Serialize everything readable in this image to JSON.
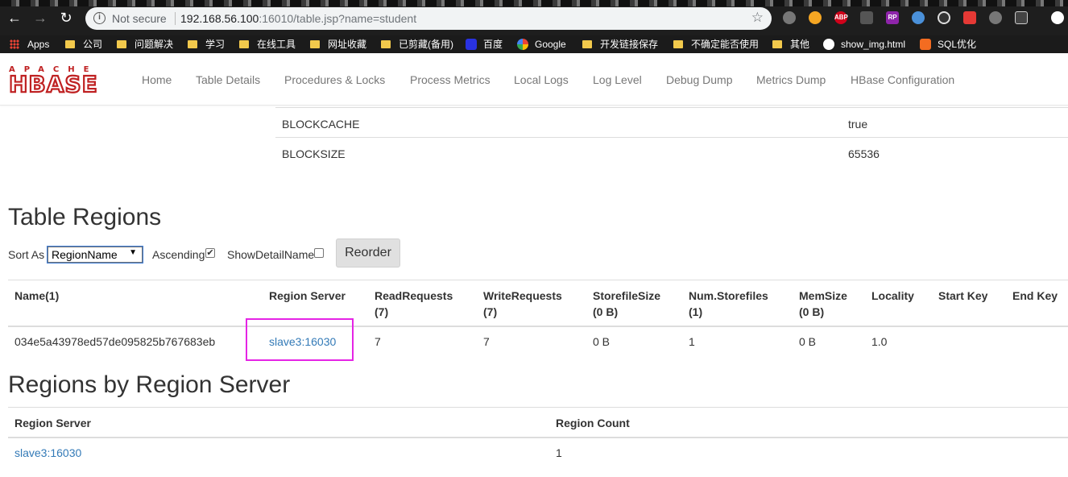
{
  "browser": {
    "security": "Not secure",
    "url_host": "192.168.56.100",
    "url_rest": ":16010/table.jsp?name=student"
  },
  "bookmarks": [
    "Apps",
    "公司",
    "问题解决",
    "学习",
    "在线工具",
    "网址收藏",
    "已剪藏(备用)",
    "百度",
    "Google",
    "开发链接保存",
    "不确定能否使用",
    "其他",
    "show_img.html",
    "SQL优化"
  ],
  "logo": {
    "top": "APACHE",
    "main": "HBASE"
  },
  "nav": [
    "Home",
    "Table Details",
    "Procedures & Locks",
    "Process Metrics",
    "Local Logs",
    "Log Level",
    "Debug Dump",
    "Metrics Dump",
    "HBase Configuration"
  ],
  "attributes": [
    {
      "key": "BLOCKCACHE",
      "value": "true"
    },
    {
      "key": "BLOCKSIZE",
      "value": "65536"
    }
  ],
  "table_regions": {
    "title": "Table Regions",
    "sort_label": "Sort As",
    "sort_value": "RegionName",
    "ascending_label": "Ascending",
    "ascending_checked": true,
    "detail_label": "ShowDetailName",
    "detail_checked": false,
    "reorder_label": "Reorder",
    "headers": [
      [
        "Name(1)",
        ""
      ],
      [
        "Region Server",
        ""
      ],
      [
        "ReadRequests",
        "(7)"
      ],
      [
        "WriteRequests",
        "(7)"
      ],
      [
        "StorefileSize",
        "(0 B)"
      ],
      [
        "Num.Storefiles",
        "(1)"
      ],
      [
        "MemSize",
        "(0 B)"
      ],
      [
        "Locality",
        ""
      ],
      [
        "Start Key",
        ""
      ],
      [
        "End Key",
        ""
      ]
    ],
    "rows": [
      [
        "034e5a43978ed57de095825b767683eb",
        "slave3:16030",
        "7",
        "7",
        "0 B",
        "1",
        "0 B",
        "1.0",
        "",
        ""
      ]
    ]
  },
  "regions_by_server": {
    "title": "Regions by Region Server",
    "headers": [
      "Region Server",
      "Region Count"
    ],
    "rows": [
      [
        "slave3:16030",
        "1"
      ]
    ]
  },
  "colors": {
    "logo_red": "#bf2021",
    "link": "#337ab7",
    "highlight": "#e524e5"
  }
}
